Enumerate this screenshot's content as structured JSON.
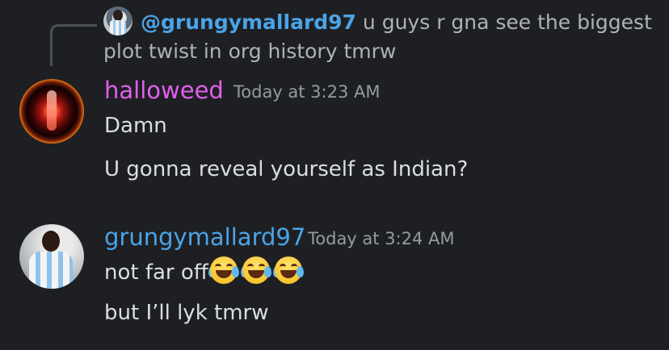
{
  "reply": {
    "mention": "@grungymallard97",
    "text": "u guys r gna see the biggest plot twist in org history tmrw"
  },
  "messages": [
    {
      "author": "halloweed",
      "author_color": "#e25ff0",
      "timestamp": "Today at 3:23 AM",
      "lines": [
        "Damn",
        "U gonna reveal yourself as Indian?"
      ]
    },
    {
      "author": "grungymallard97",
      "author_color": "#4aa4e8",
      "timestamp": "Today at 3:24 AM",
      "lines": [
        "not far off",
        "but I’ll lyk tmrw"
      ],
      "emoji": [
        "face-with-tears-of-joy",
        "face-with-tears-of-joy",
        "face-with-tears-of-joy"
      ]
    }
  ],
  "colors": {
    "background": "#1e1f22",
    "text": "#dbdee1",
    "muted": "#949ba4"
  }
}
